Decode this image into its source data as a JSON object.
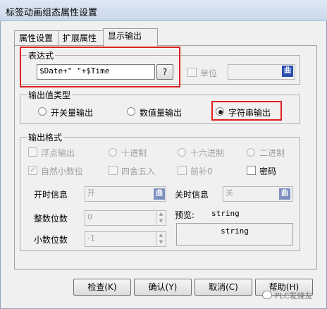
{
  "window": {
    "title": "标签动画组态属性设置"
  },
  "tabs": [
    {
      "label": "属性设置"
    },
    {
      "label": "扩展属性"
    },
    {
      "label": "显示输出",
      "active": true
    }
  ],
  "expression": {
    "legend": "表达式",
    "value": "$Date+\" \"+$Time",
    "browse_label": "?",
    "unit_label": "单位",
    "unit_value": ""
  },
  "value_type": {
    "legend": "输出值类型",
    "options": [
      {
        "label": "开关量输出",
        "selected": false
      },
      {
        "label": "数值量输出",
        "selected": false
      },
      {
        "label": "字符串输出",
        "selected": true
      }
    ]
  },
  "format": {
    "legend": "输出格式",
    "float_label": "浮点输出",
    "dec_label": "十进制",
    "hex_label": "十六进制",
    "bin_label": "二进制",
    "natural_label": "自然小数位",
    "round_label": "四舍五入",
    "pad_label": "前补0",
    "password_label": "密码",
    "on_label": "开时信息",
    "on_value": "开",
    "off_label": "关时信息",
    "off_value": "关",
    "int_digits_label": "整数位数",
    "int_digits_value": "0",
    "dec_digits_label": "小数位数",
    "dec_digits_value": "-1",
    "preview_label": "预览:",
    "preview_text": "string",
    "preview_box_text": "string"
  },
  "buttons": {
    "check": "检查(K)",
    "ok": "确认(Y)",
    "cancel": "取消(C)",
    "help": "帮助(H)"
  },
  "icons": {
    "edit_icon_text": "曲"
  },
  "watermark": "PLC发烧友",
  "colors": {
    "highlight": "#e02020",
    "icon": "#2b4fb0"
  }
}
